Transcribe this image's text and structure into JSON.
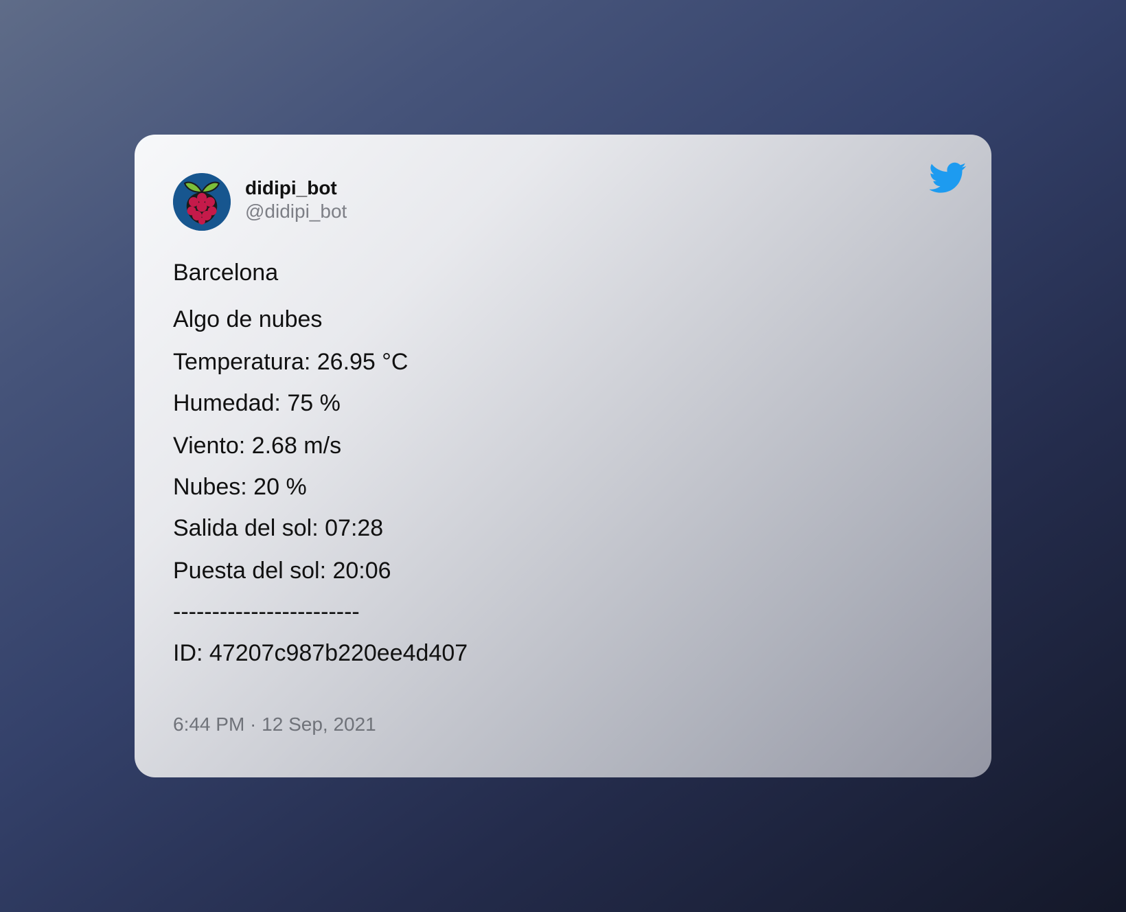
{
  "tweet": {
    "author": {
      "display_name": "didipi_bot",
      "handle": "@didipi_bot",
      "avatar_icon": "raspberry-pi-logo-icon"
    },
    "brand_icon": "twitter-bird-icon",
    "brand_color": "#1d9bf0",
    "lines": [
      "Barcelona",
      "Algo de nubes",
      "Temperatura: 26.95 °C",
      "Humedad: 75 %",
      "Viento: 2.68 m/s",
      "Nubes: 20 %",
      "Salida del sol: 07:28",
      "Puesta del sol: 20:06",
      "------------------------",
      "ID: 47207c987b220ee4d407"
    ],
    "timestamp": "6:44 PM · 12 Sep, 2021"
  }
}
